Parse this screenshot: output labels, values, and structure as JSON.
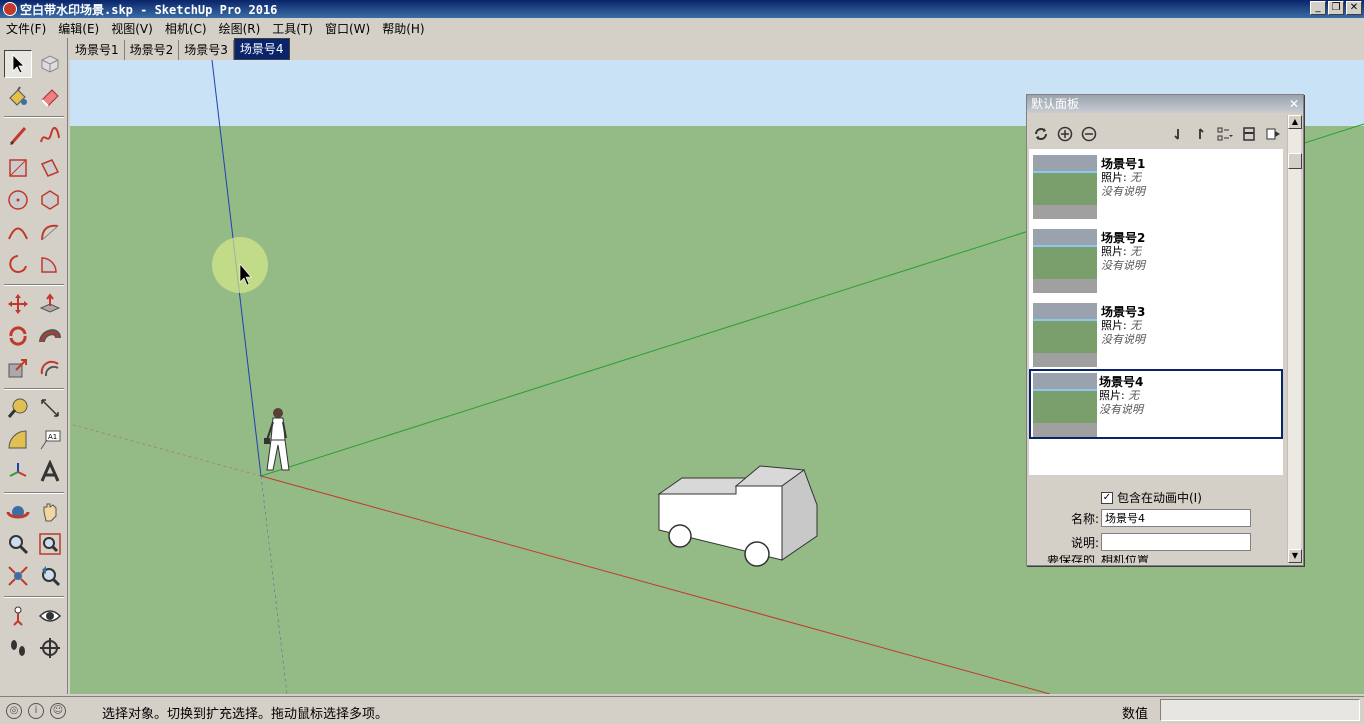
{
  "window": {
    "title": "空白带水印场景.skp - SketchUp Pro 2016",
    "minimize": "_",
    "restore": "❐",
    "close": "✕"
  },
  "menu": [
    "文件(F)",
    "编辑(E)",
    "视图(V)",
    "相机(C)",
    "绘图(R)",
    "工具(T)",
    "窗口(W)",
    "帮助(H)"
  ],
  "scene_tabs": [
    "场景号1",
    "场景号2",
    "场景号3",
    "场景号4"
  ],
  "active_scene_tab": 3,
  "panel": {
    "title": "默认面板",
    "close": "✕",
    "scenes": [
      {
        "name": "场景号1",
        "photo_label": "照片:",
        "photo_value": "无",
        "description": "没有说明"
      },
      {
        "name": "场景号2",
        "photo_label": "照片:",
        "photo_value": "无",
        "description": "没有说明"
      },
      {
        "name": "场景号3",
        "photo_label": "照片:",
        "photo_value": "无",
        "description": "没有说明"
      },
      {
        "name": "场景号4",
        "photo_label": "照片:",
        "photo_value": "无",
        "description": "没有说明"
      }
    ],
    "selected_scene": 3,
    "include_in_animation_label": "包含在动画中(I)",
    "include_in_animation_checked": true,
    "name_label": "名称:",
    "name_value": "场景号4",
    "description_label": "说明:",
    "description_value": "",
    "properties_to_save_label": "要保存的",
    "camera_location_label": "相机位置"
  },
  "statusbar": {
    "hint": "选择对象。切换到扩充选择。拖动鼠标选择多项。",
    "measurements_label": "数值",
    "measurements_value": ""
  },
  "colors": {
    "sky": "#c9e2f5",
    "ground": "#94bb86",
    "axis_red": "#c0392b",
    "axis_green": "#2e9d2e",
    "axis_blue": "#1f3fb5",
    "selection": "#0a246a"
  }
}
